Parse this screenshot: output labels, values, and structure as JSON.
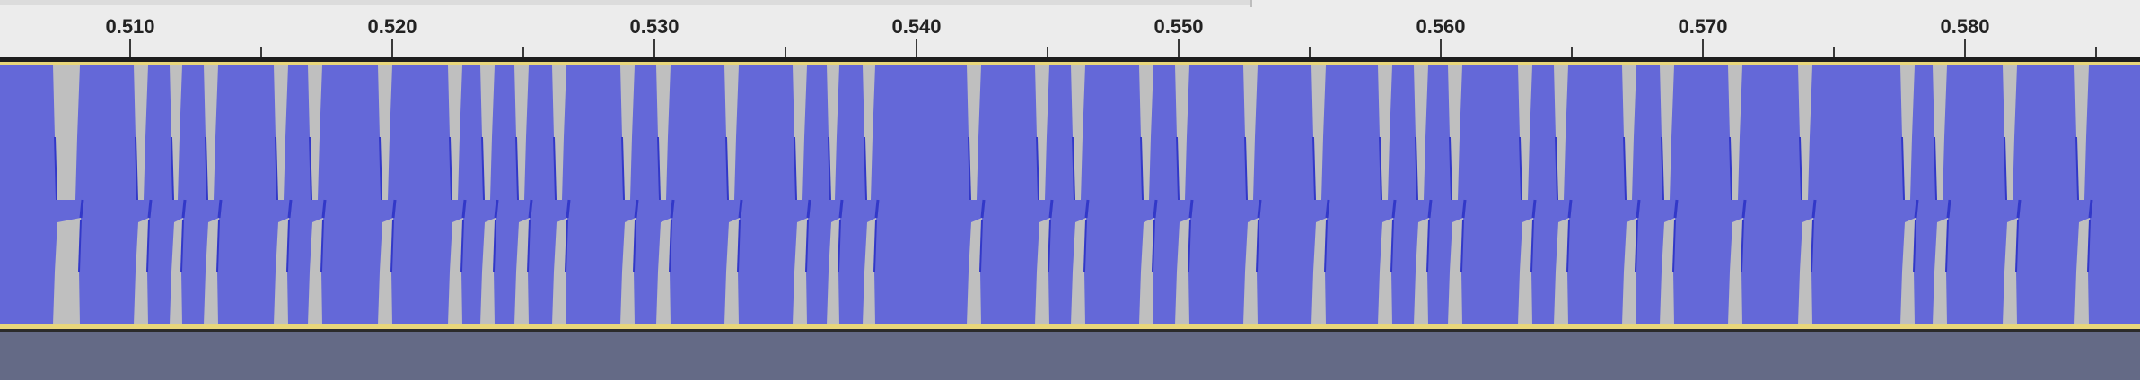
{
  "ruler": {
    "labels": [
      "0.510",
      "0.520",
      "0.530",
      "0.540",
      "0.550",
      "0.560",
      "0.570",
      "0.580"
    ],
    "unit": "seconds"
  },
  "waveform": {
    "type": "audio-waveform",
    "view": "zoomed",
    "time_range": [
      0.505,
      0.587
    ],
    "colors": {
      "wave": "#6468d8",
      "background": "#bfbfbf",
      "edge": "#3238c8",
      "selection_border": "#e8d67a",
      "empty_area": "#646a86"
    }
  }
}
